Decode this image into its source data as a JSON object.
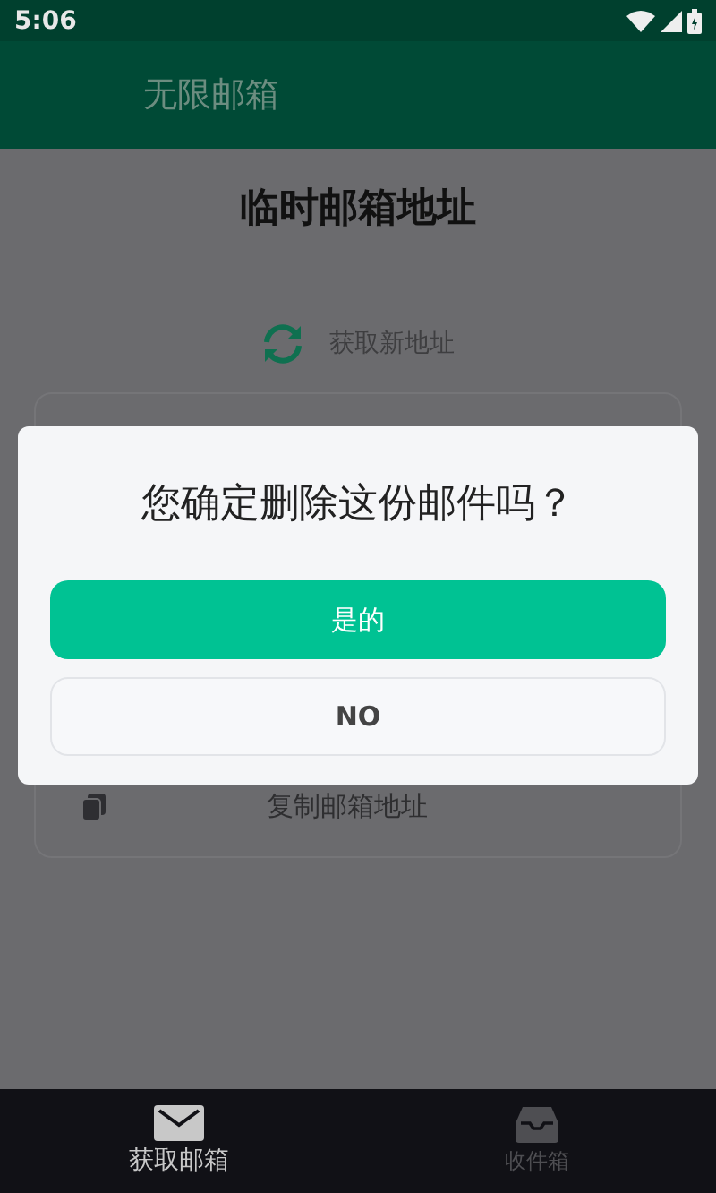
{
  "status_bar": {
    "time": "5:06"
  },
  "app_bar": {
    "title": "无限邮箱"
  },
  "page": {
    "title": "临时邮箱地址",
    "refresh_label": "获取新地址",
    "copy_label": "复制邮箱地址"
  },
  "dialog": {
    "message": "您确定删除这份邮件吗？",
    "buttons": [
      {
        "label": "是的",
        "kind": "primary"
      },
      {
        "label": "NO",
        "kind": "secondary"
      }
    ]
  },
  "bottom_nav": [
    {
      "label": "获取邮箱",
      "selected": true
    },
    {
      "label": "收件箱",
      "selected": false
    }
  ]
}
